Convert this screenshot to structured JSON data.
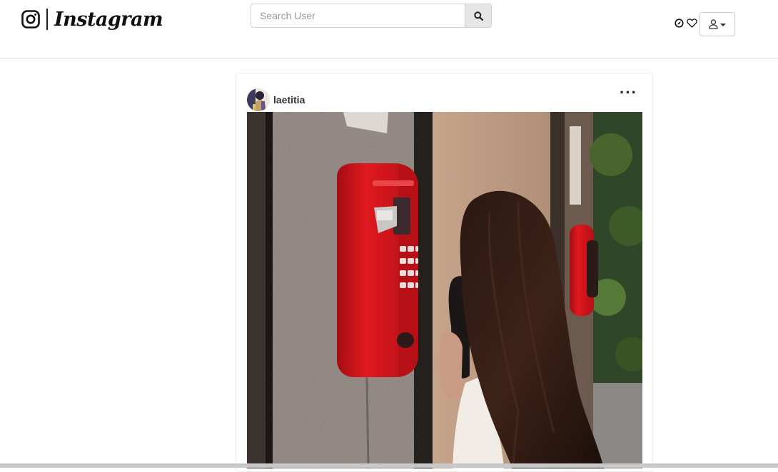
{
  "brand": {
    "name": "Instagram",
    "logo_icon": "instagram-camera-icon"
  },
  "search": {
    "placeholder": "Search User",
    "value": "",
    "button_icon": "search-icon"
  },
  "nav": {
    "icons": [
      "compass-icon",
      "heart-icon"
    ],
    "user_menu_icon": "user-icon"
  },
  "post": {
    "username": "laetitia",
    "more_label": "···",
    "image_alt": "Woman with long dark hair talking on a red wall-mounted payphone"
  },
  "colors": {
    "phone_red": "#d9161c",
    "border": "#e2e2e2",
    "text": "#333333"
  }
}
